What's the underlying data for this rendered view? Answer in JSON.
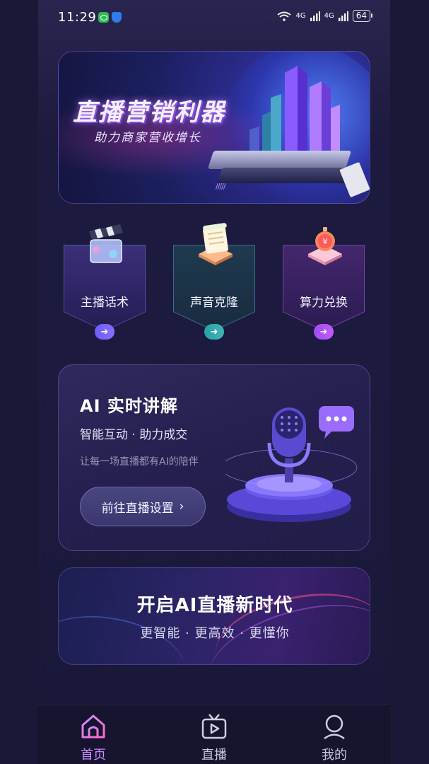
{
  "status_bar": {
    "time": "11:29",
    "network_1": "4G",
    "network_2": "4G",
    "battery": "64"
  },
  "banner": {
    "title": "直播营销利器",
    "subtitle": "助力商家营收增长",
    "stripes": "/////"
  },
  "features": [
    {
      "label": "主播话术",
      "arrow": "➜",
      "icon": "clapperboard-icon"
    },
    {
      "label": "声音克隆",
      "arrow": "➜",
      "icon": "document-scroll-icon"
    },
    {
      "label": "算力兑换",
      "arrow": "➜",
      "icon": "stopwatch-badge-icon"
    }
  ],
  "ai_card": {
    "title": "AI 实时讲解",
    "subtitle": "智能互动 · 助力成交",
    "description": "让每一场直播都有AI的陪伴",
    "button_label": "前往直播设置",
    "button_chevron": "›"
  },
  "promo": {
    "title": "开启AI直播新时代",
    "subtitle": "更智能 · 更高效 · 更懂你"
  },
  "tabbar": {
    "items": [
      {
        "label": "首页",
        "icon": "home-icon",
        "active": true
      },
      {
        "label": "直播",
        "icon": "tv-play-icon",
        "active": false
      },
      {
        "label": "我的",
        "icon": "user-icon",
        "active": false
      }
    ]
  },
  "colors": {
    "accent_purple": "#c78cff",
    "background": "#1b1a3d"
  }
}
